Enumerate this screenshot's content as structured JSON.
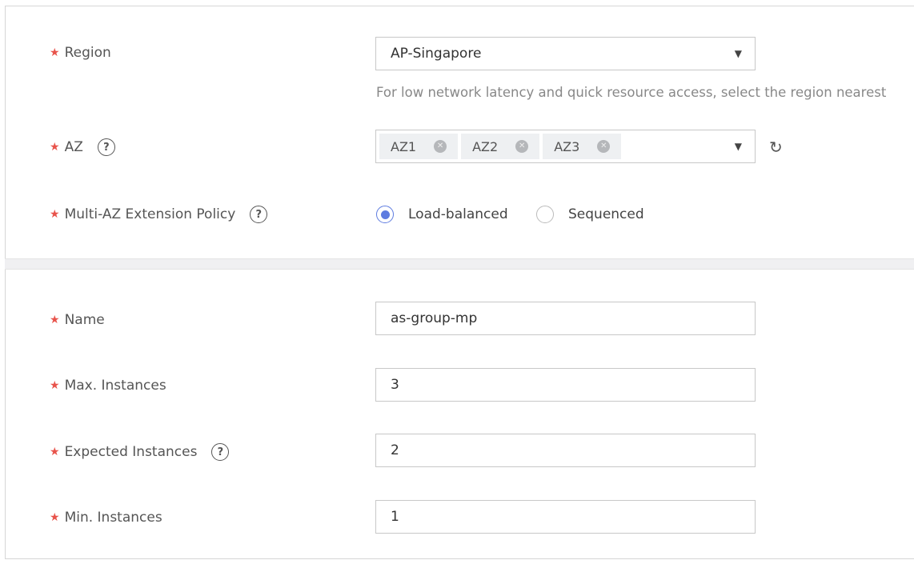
{
  "region": {
    "label": "Region",
    "value": "AP-Singapore",
    "hint": "For low network latency and quick resource access, select the region nearest"
  },
  "az": {
    "label": "AZ",
    "tags": [
      "AZ1",
      "AZ2",
      "AZ3"
    ]
  },
  "policy": {
    "label": "Multi-AZ Extension Policy",
    "options": [
      {
        "label": "Load-balanced",
        "selected": true
      },
      {
        "label": "Sequenced",
        "selected": false
      }
    ]
  },
  "name": {
    "label": "Name",
    "value": "as-group-mp"
  },
  "max": {
    "label": "Max. Instances",
    "value": "3"
  },
  "expected": {
    "label": "Expected Instances",
    "value": "2"
  },
  "min": {
    "label": "Min. Instances",
    "value": "1"
  },
  "colors": {
    "required": "#e8534b",
    "accent": "#5e7ce0"
  }
}
